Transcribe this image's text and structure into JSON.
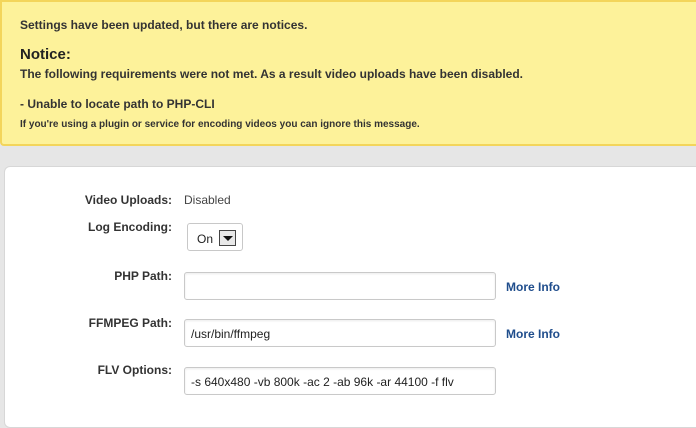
{
  "notice": {
    "summary": "Settings have been updated, but there are notices.",
    "title": "Notice:",
    "requirements": "The following requirements were not met. As a result video uploads have been disabled.",
    "item": "- Unable to locate path to PHP-CLI",
    "hint": "If you're using a plugin or service for encoding videos you can ignore this message."
  },
  "form": {
    "video_uploads": {
      "label": "Video Uploads:",
      "value": "Disabled"
    },
    "log_encoding": {
      "label": "Log Encoding:",
      "value": "On"
    },
    "php_path": {
      "label": "PHP Path:",
      "value": "",
      "more": "More Info"
    },
    "ffmpeg_path": {
      "label": "FFMPEG Path:",
      "value": "/usr/bin/ffmpeg",
      "more": "More Info"
    },
    "flv_options": {
      "label": "FLV Options:",
      "value": "-s 640x480 -vb 800k -ac 2 -ab 96k -ar 44100 -f flv"
    }
  },
  "colors": {
    "notice_bg": "#fdf29a",
    "notice_border": "#f3d55b",
    "link": "#1f4d8c"
  }
}
